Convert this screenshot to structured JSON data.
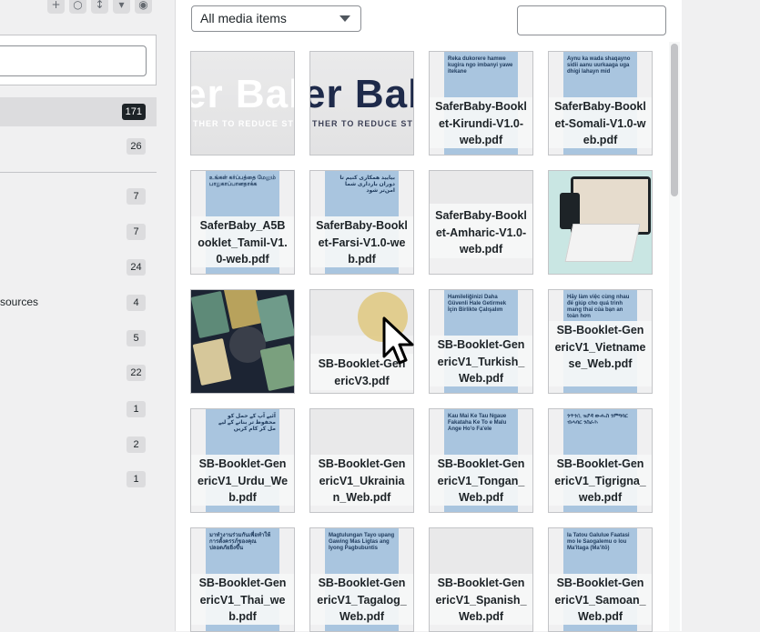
{
  "toolbar_icons": [
    "plus-icon",
    "circle-icon",
    "sort-icon",
    "collapse-icon",
    "eye-icon"
  ],
  "sidebar": {
    "folders": [
      {
        "label": "",
        "count": "171",
        "active": true
      },
      {
        "label": "",
        "count": "26"
      },
      {
        "label": "",
        "count": "7"
      },
      {
        "label": "",
        "count": "7"
      },
      {
        "label": "",
        "count": "24"
      },
      {
        "label": "sources",
        "count": "4"
      },
      {
        "label": "",
        "count": "5"
      },
      {
        "label": "",
        "count": "22"
      },
      {
        "label": "",
        "count": "1"
      },
      {
        "label": "",
        "count": "2"
      },
      {
        "label": "",
        "count": "1"
      }
    ]
  },
  "filter": {
    "selected": "All media items"
  },
  "search": {
    "placeholder": ""
  },
  "banners": {
    "main": "er Baby",
    "main_alt": "er Bab",
    "sub": "THER TO REDUCE STI"
  },
  "tiles": [
    {
      "label": "",
      "thumb": "banner-white"
    },
    {
      "label": "",
      "thumb": "banner-dark"
    },
    {
      "label": "SaferBaby-Booklet-Kirundi-V1.0-web.pdf",
      "thumb_text": "Reka dukorere hamwe kugira ngo imbanyi yawe itekane"
    },
    {
      "label": "SaferBaby-Booklet-Somali-V1.0-web.pdf",
      "thumb_text": "Aynu ka wada shaqayno sidii aanu uurkaaga uga dhigi lahayn mid"
    },
    {
      "label": "SaferBaby_A5Booklet_Tamil-V1.0-web.pdf",
      "thumb_text": "உங்கள் கர்ப்பத்தை மேலும் பாதுகாப்பானதாக்க"
    },
    {
      "label": "SaferBaby-Booklet-Farsi-V1.0-web.pdf",
      "thumb_text": "بیایید همکاری کنیم تا دوران بارداری شما امن‌تر شود"
    },
    {
      "label": "SaferBaby-Booklet-Amharic-V1.0-web.pdf",
      "thumb_text": ""
    },
    {
      "label": "",
      "thumb": "tablet"
    },
    {
      "label": "",
      "thumb": "collage"
    },
    {
      "label": "SB-Booklet-GenericV3.pdf",
      "thumb_text": ""
    },
    {
      "label": "SB-Booklet-GenericV1_Turkish_Web.pdf",
      "thumb_text": "Hamileliğinizi Daha Güvenli Hale Getirmek İçin Birlikte Çalışalım"
    },
    {
      "label": "SB-Booklet-GenericV1_Vietnamese_Web.pdf",
      "thumb_text": "Hãy làm việc cùng nhau để giúp cho quá trình mang thai của bạn an toàn hơn"
    },
    {
      "label": "SB-Booklet-GenericV1_Urdu_Web.pdf",
      "thumb_text": "آئیے آپ کے حمل کو محفوظ تر بنانے کے لیے مل کر کام کریں"
    },
    {
      "label": "SB-Booklet-GenericV1_Ukrainian_Web.pdf",
      "thumb_text": ""
    },
    {
      "label": "SB-Booklet-GenericV1_Tongan_Web.pdf",
      "thumb_text": "Kau Mai Ke Tau Ngaue Fakataha Ke To e Malu Ange Ho'o Fa'ele"
    },
    {
      "label": "SB-Booklet-GenericV1_Tigrigna_web.pdf",
      "thumb_text": "ንጥንሲ ዝያዳ ውሑስ ንምግባር ብሓባር ንስራሕ"
    },
    {
      "label": "SB-Booklet-GenericV1_Thai_web.pdf",
      "thumb_text": "มาทำงานร่วมกันเพื่อทำให้การตั้งครรภ์ของคุณปลอดภัยยิ่งขึ้น"
    },
    {
      "label": "SB-Booklet-GenericV1_Tagalog_Web.pdf",
      "thumb_text": "Magtulungan Tayo upang Gawing Mas Ligtas ang Iyong Pagbubuntis"
    },
    {
      "label": "SB-Booklet-GenericV1_Spanish_Web.pdf",
      "thumb_text": ""
    },
    {
      "label": "SB-Booklet-GenericV1_Samoan_Web.pdf",
      "thumb_text": "Ia Tatou Galulue Faatasi mo le Saogalemu o lou Ma'itaga (Ma'itō)"
    }
  ]
}
